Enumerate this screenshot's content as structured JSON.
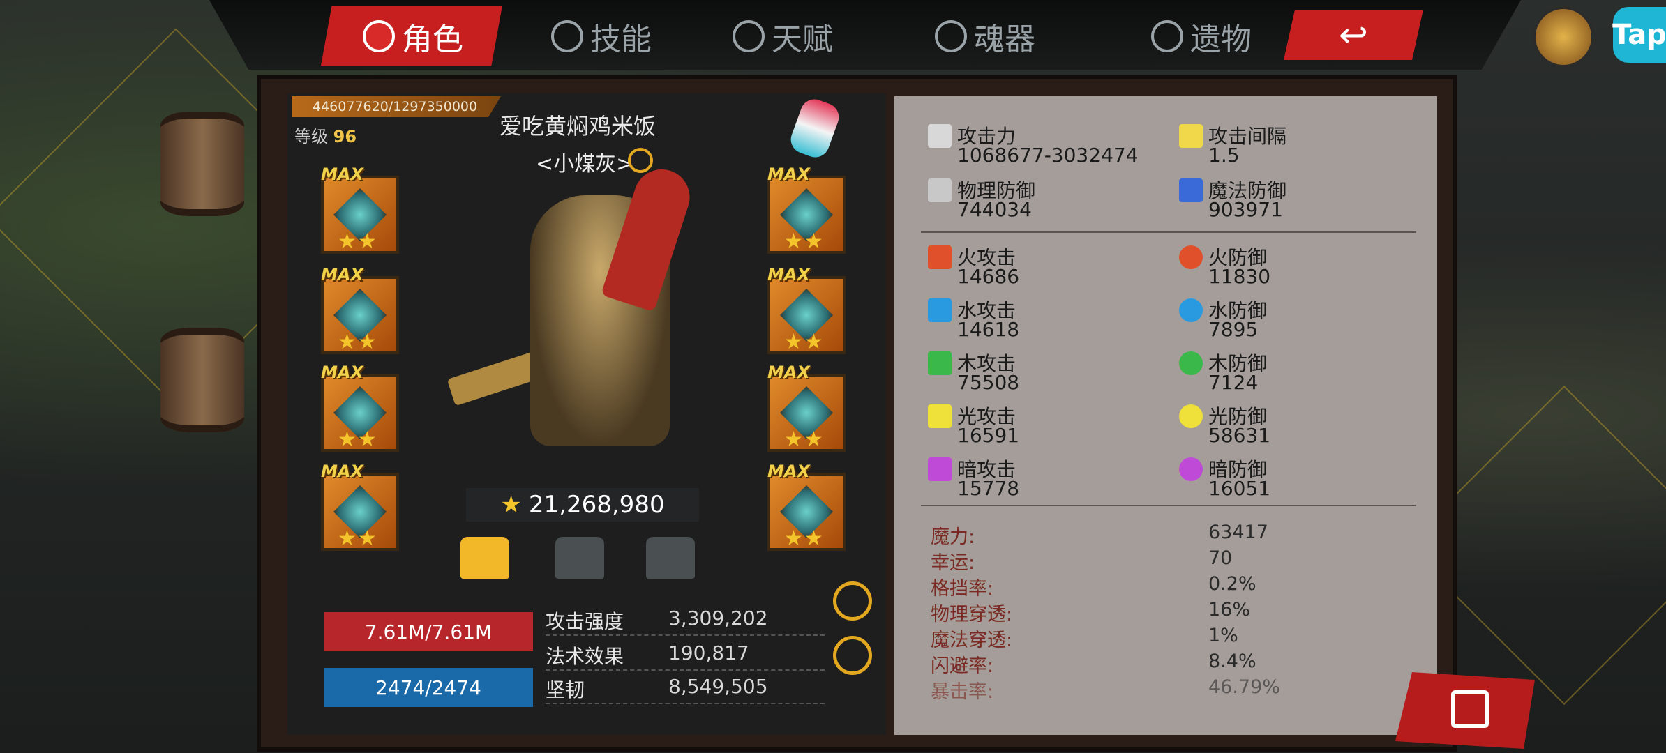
{
  "nav": {
    "tabs": [
      {
        "label": "角色",
        "active": true
      },
      {
        "label": "技能",
        "active": false
      },
      {
        "label": "天赋",
        "active": false
      },
      {
        "label": "魂器",
        "active": false
      },
      {
        "label": "遗物",
        "active": false
      }
    ],
    "tap_label": "Tap"
  },
  "character": {
    "exp": "446077620/1297350000",
    "level_label": "等级",
    "level_value": "96",
    "name": "爱吃黄焖鸡米饭",
    "title": "<小煤灰>",
    "power": "21,268,980",
    "equipment_slots": [
      {
        "badge": "MAX",
        "stars": "★★"
      },
      {
        "badge": "MAX",
        "stars": "★★"
      },
      {
        "badge": "MAX",
        "stars": "★★"
      },
      {
        "badge": "MAX",
        "stars": "★★"
      },
      {
        "badge": "MAX",
        "stars": "★★"
      },
      {
        "badge": "MAX",
        "stars": "★★"
      },
      {
        "badge": "MAX",
        "stars": "★★"
      },
      {
        "badge": "MAX",
        "stars": "★★"
      }
    ],
    "hp": "7.61M/7.61M",
    "mp": "2474/2474",
    "basic_stats": [
      {
        "label": "攻击强度",
        "value": "3,309,202"
      },
      {
        "label": "法术效果",
        "value": "190,817"
      },
      {
        "label": "坚韧",
        "value": "8,549,505"
      }
    ]
  },
  "stats": {
    "primary": [
      {
        "label": "攻击力",
        "value": "1068677-3032474",
        "icon": "sword-icon"
      },
      {
        "label": "攻击间隔",
        "value": "1.5",
        "icon": "speed-sword-icon"
      },
      {
        "label": "物理防御",
        "value": "744034",
        "icon": "physical-defense-icon"
      },
      {
        "label": "魔法防御",
        "value": "903971",
        "icon": "magic-defense-icon"
      }
    ],
    "elemental": [
      {
        "label": "火攻击",
        "value": "14686",
        "icon": "fire-attack-icon",
        "color": "#e0502a"
      },
      {
        "label": "火防御",
        "value": "11830",
        "icon": "fire-defense-icon",
        "color": "#e0502a"
      },
      {
        "label": "水攻击",
        "value": "14618",
        "icon": "water-attack-icon",
        "color": "#2a9ae0"
      },
      {
        "label": "水防御",
        "value": "7895",
        "icon": "water-defense-icon",
        "color": "#2a9ae0"
      },
      {
        "label": "木攻击",
        "value": "75508",
        "icon": "wood-attack-icon",
        "color": "#3ab84a"
      },
      {
        "label": "木防御",
        "value": "7124",
        "icon": "wood-defense-icon",
        "color": "#3ab84a"
      },
      {
        "label": "光攻击",
        "value": "16591",
        "icon": "light-attack-icon",
        "color": "#f0e03a"
      },
      {
        "label": "光防御",
        "value": "58631",
        "icon": "light-defense-icon",
        "color": "#f0e03a"
      },
      {
        "label": "暗攻击",
        "value": "15778",
        "icon": "dark-attack-icon",
        "color": "#c04ad8"
      },
      {
        "label": "暗防御",
        "value": "16051",
        "icon": "dark-defense-icon",
        "color": "#c04ad8"
      }
    ],
    "secondary": [
      {
        "label": "魔力:",
        "value": "63417"
      },
      {
        "label": "幸运:",
        "value": "70"
      },
      {
        "label": "格挡率:",
        "value": "0.2%"
      },
      {
        "label": "物理穿透:",
        "value": "16%"
      },
      {
        "label": "魔法穿透:",
        "value": "1%"
      },
      {
        "label": "闪避率:",
        "value": "8.4%"
      },
      {
        "label": "暴击率:",
        "value": "46.79%"
      }
    ]
  }
}
